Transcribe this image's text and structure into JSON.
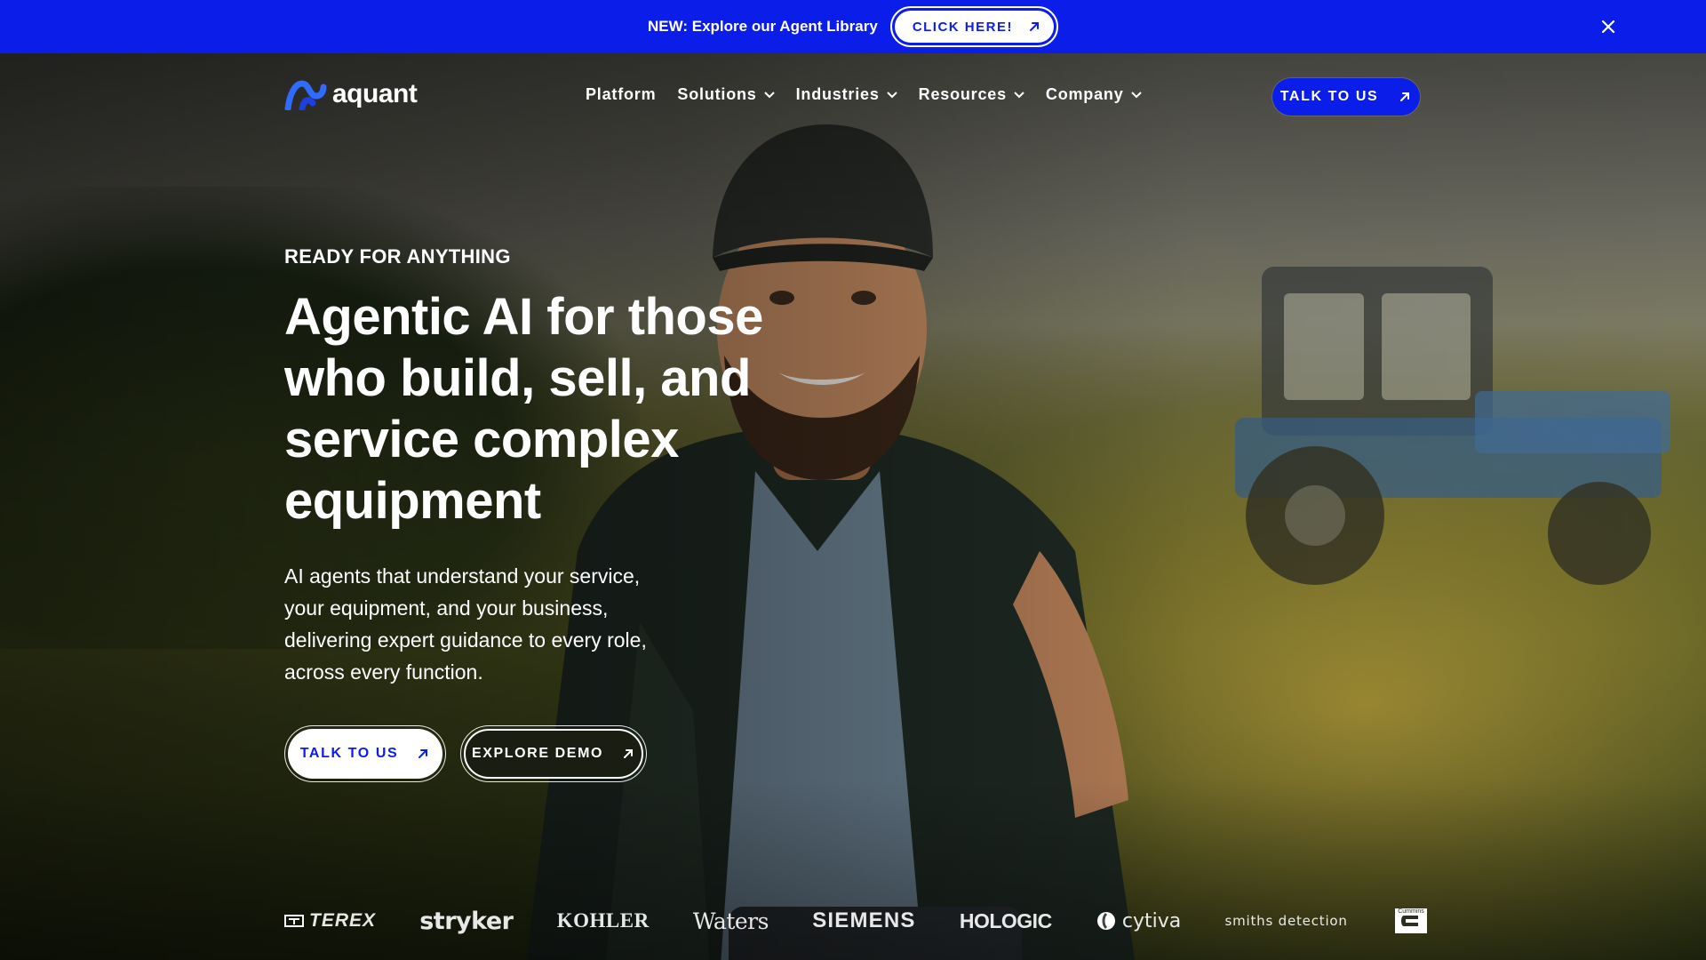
{
  "announcement": {
    "text": "NEW: Explore our Agent Library",
    "cta_label": "CLICK HERE!"
  },
  "nav": {
    "logo_text": "aquant",
    "items": [
      {
        "label": "Platform",
        "has_dropdown": false
      },
      {
        "label": "Solutions",
        "has_dropdown": true
      },
      {
        "label": "Industries",
        "has_dropdown": true
      },
      {
        "label": "Resources",
        "has_dropdown": true
      },
      {
        "label": "Company",
        "has_dropdown": true
      }
    ],
    "cta_label": "TALK TO US"
  },
  "hero": {
    "eyebrow": "READY FOR ANYTHING",
    "headline": "Agentic AI for those who build, sell, and service complex equipment",
    "subcopy": "AI agents that understand your service, your equipment, and your business, delivering expert guidance to every role, across every function.",
    "primary_cta": "TALK TO US",
    "secondary_cta": "EXPLORE DEMO"
  },
  "customer_logos": [
    {
      "name": "TEREX"
    },
    {
      "name": "stryker"
    },
    {
      "name": "KOHLER"
    },
    {
      "name": "Waters"
    },
    {
      "name": "SIEMENS"
    },
    {
      "name": "HOLOGIC"
    },
    {
      "name": "cytiva"
    },
    {
      "name": "smiths detection"
    },
    {
      "name": "Cummins"
    }
  ],
  "colors": {
    "brand_blue": "#0b1de8",
    "white": "#ffffff",
    "dark_button": "#1a1d12"
  },
  "icons": {
    "arrow": "arrow-up-right-icon",
    "close": "close-icon",
    "chevron": "chevron-down-icon"
  }
}
